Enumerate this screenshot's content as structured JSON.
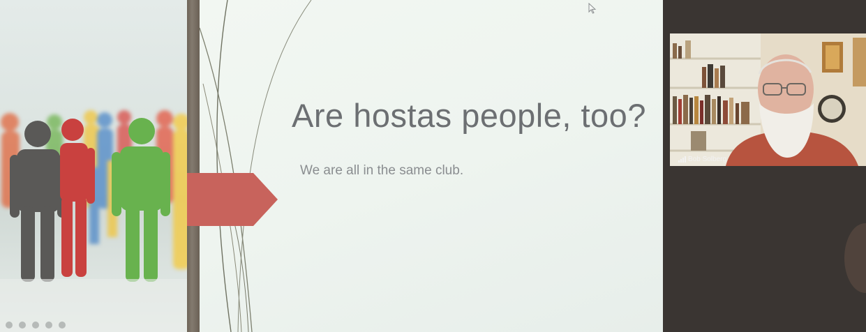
{
  "slide": {
    "title": "Are hostas people, too?",
    "subtitle": "We are all in the same club."
  },
  "video": {
    "participant_name": "Bob Solberg",
    "icons": [
      "signal-bars-icon"
    ]
  },
  "colors": {
    "arrow": "#c8635c",
    "slide_background": "#eef4ef",
    "title_text": "#6c6f72"
  }
}
